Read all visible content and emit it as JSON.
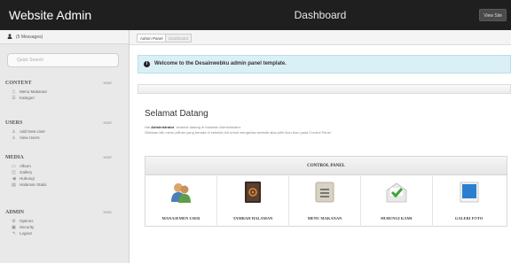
{
  "header": {
    "brand": "Website Admin",
    "title": "Dashboard",
    "view_site": "View Site"
  },
  "sidebar": {
    "messages": "(5 Messages)",
    "search_placeholder": "Quick Search",
    "sections": [
      {
        "title": "CONTENT",
        "hide": "HIDE",
        "items": [
          {
            "label": "Menu Makanan",
            "icon": "document-icon"
          },
          {
            "label": "Kategori",
            "icon": "list-icon"
          }
        ]
      },
      {
        "title": "USERS",
        "hide": "HIDE",
        "items": [
          {
            "label": "Add New User",
            "icon": "add-user-icon"
          },
          {
            "label": "View Users",
            "icon": "users-icon"
          }
        ]
      },
      {
        "title": "MEDIA",
        "hide": "HIDE",
        "items": [
          {
            "label": "Album",
            "icon": "folder-icon"
          },
          {
            "label": "Gallery",
            "icon": "gallery-icon"
          },
          {
            "label": "Hubungi",
            "icon": "audio-icon"
          },
          {
            "label": "Halaman Statis",
            "icon": "page-icon"
          }
        ]
      },
      {
        "title": "ADMIN",
        "hide": "HIDE",
        "items": [
          {
            "label": "Options",
            "icon": "options-icon"
          },
          {
            "label": "Security",
            "icon": "lock-icon"
          },
          {
            "label": "Logout",
            "icon": "logout-icon"
          }
        ]
      }
    ]
  },
  "tabs": [
    "Admin Panel",
    "Dashboard"
  ],
  "alert": {
    "text": "Welcome to the Desainwebku admin panel template."
  },
  "welcome": {
    "title": "Selamat Datang",
    "line1_prefix": "Hai",
    "line1_name": "Administrator",
    "line1_rest": ", selamat datang di halaman Administrator.",
    "line2": "Silahkan klik menu pilihan yang berada di sebelah kiri untuk mengelola website atau pilih ikon-ikon pada Control Panel"
  },
  "control_panel": {
    "title": "CONTROL PANEL",
    "items": [
      {
        "label": "MANAJEMEN USER",
        "icon": "users-icon"
      },
      {
        "label": "TAMBAH HALAMAN",
        "icon": "address-book-icon"
      },
      {
        "label": "MENU MAKANAN",
        "icon": "document-icon"
      },
      {
        "label": "HUBUNGI KAMI",
        "icon": "mail-icon"
      },
      {
        "label": "GALERI FOTO",
        "icon": "photo-icon"
      }
    ]
  },
  "colors": {
    "header_bg": "#1f1f1f",
    "sidebar_bg": "#e9e9e9",
    "alert_bg": "#d9f0f6"
  }
}
